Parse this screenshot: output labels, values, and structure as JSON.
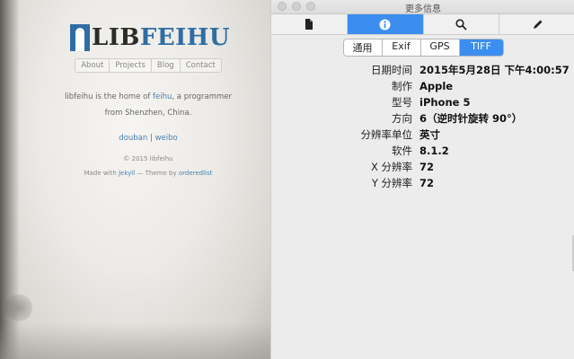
{
  "photo": {
    "logo": {
      "lib": "LIB",
      "feihu": "FEIHU"
    },
    "nav": [
      "About",
      "Projects",
      "Blog",
      "Contact"
    ],
    "desc_pre": "libfeihu is the home of ",
    "desc_link": "feihu",
    "desc_post": ", a programmer",
    "desc_line2": "from Shenzhen, China.",
    "link_douban": "douban",
    "link_sep": "|",
    "link_weibo": "weibo",
    "copyright": "© 2015 libfeihu",
    "made_pre": "Made with ",
    "made_jekyll": "Jekyll",
    "made_mid": " — Theme by ",
    "made_author": "orderedlist"
  },
  "window": {
    "title": "更多信息",
    "toolbar_icons": [
      "document-icon",
      "info-icon",
      "search-icon",
      "pencil-icon"
    ],
    "active_tool": 1,
    "tabs": [
      "通用",
      "Exif",
      "GPS",
      "TIFF"
    ],
    "active_tab": 3,
    "rows": [
      {
        "label": "日期时间",
        "value": "2015年5月28日 下午4:00:57"
      },
      {
        "label": "制作",
        "value": "Apple"
      },
      {
        "label": "型号",
        "value": "iPhone 5"
      },
      {
        "label": "方向",
        "value": "6（逆时针旋转 90°）"
      },
      {
        "label": "分辨率单位",
        "value": "英寸"
      },
      {
        "label": "软件",
        "value": "8.1.2"
      },
      {
        "label": "X 分辨率",
        "value": "72"
      },
      {
        "label": "Y 分辨率",
        "value": "72"
      }
    ],
    "accent": "#3b8ef0"
  }
}
